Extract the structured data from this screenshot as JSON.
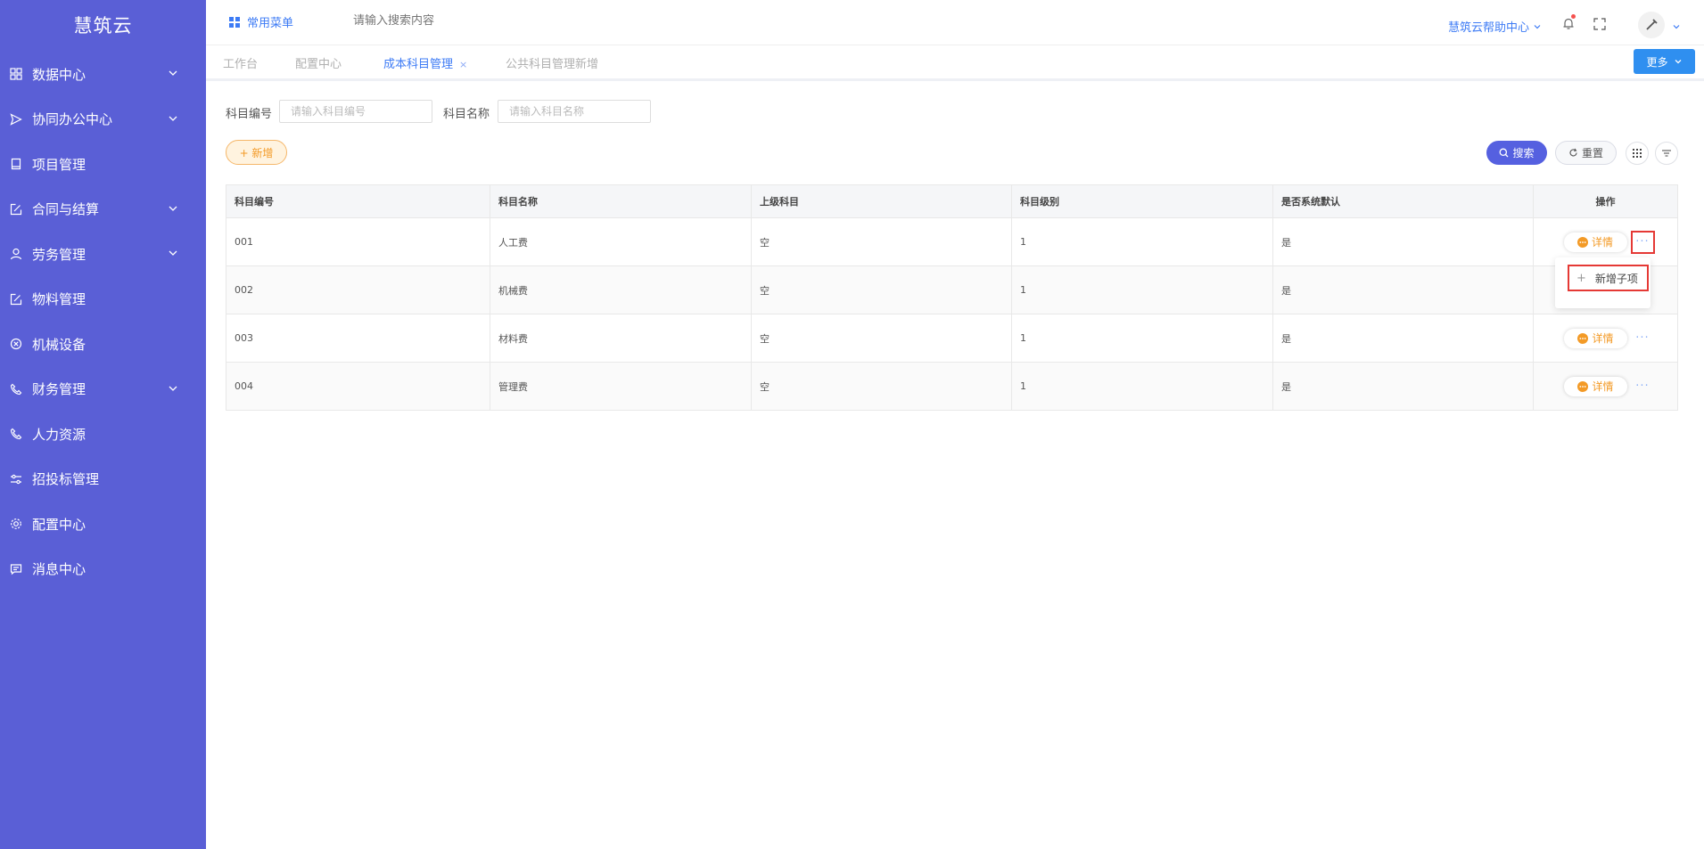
{
  "app": {
    "logo": "慧筑云"
  },
  "colors": {
    "sidebar_bg": "#5a5fd6",
    "accent": "#3d7bf5",
    "primary_btn": "#5560e0",
    "add_btn_text": "#f39a26",
    "highlight_box": "#e53935"
  },
  "sidebar": {
    "items": [
      {
        "label": "数据中心",
        "icon": "grid-icon",
        "has_chevron": true
      },
      {
        "label": "协同办公中心",
        "icon": "send-icon",
        "has_chevron": true
      },
      {
        "label": "项目管理",
        "icon": "book-icon",
        "has_chevron": false
      },
      {
        "label": "合同与结算",
        "icon": "edit-icon",
        "has_chevron": true
      },
      {
        "label": "劳务管理",
        "icon": "user-icon",
        "has_chevron": true
      },
      {
        "label": "物料管理",
        "icon": "edit-icon",
        "has_chevron": false
      },
      {
        "label": "机械设备",
        "icon": "close-circle-icon",
        "has_chevron": false
      },
      {
        "label": "财务管理",
        "icon": "phone-icon",
        "has_chevron": true
      },
      {
        "label": "人力资源",
        "icon": "phone-icon",
        "has_chevron": false
      },
      {
        "label": "招投标管理",
        "icon": "sliders-icon",
        "has_chevron": false
      },
      {
        "label": "配置中心",
        "icon": "gear-icon",
        "has_chevron": false
      },
      {
        "label": "消息中心",
        "icon": "message-icon",
        "has_chevron": false
      }
    ]
  },
  "topbar": {
    "menu_label": "常用菜单",
    "search_placeholder": "请输入搜索内容",
    "help_label": "慧筑云帮助中心"
  },
  "tabs": [
    {
      "label": "工作台",
      "active": false
    },
    {
      "label": "配置中心",
      "active": false
    },
    {
      "label": "成本科目管理",
      "active": true,
      "closable": true,
      "close_glyph": "×"
    },
    {
      "label": "公共科目管理新增",
      "active": false
    }
  ],
  "more_button": "更多",
  "filters": {
    "code_label": "科目编号",
    "code_placeholder": "请输入科目编号",
    "name_label": "科目名称",
    "name_placeholder": "请输入科目名称"
  },
  "actions": {
    "add": "+ 新增",
    "search": "搜索",
    "reset": "重置"
  },
  "table": {
    "columns": [
      "科目编号",
      "科目名称",
      "上级科目",
      "科目级别",
      "是否系统默认",
      "操作"
    ],
    "rows": [
      [
        "001",
        "人工费",
        "空",
        "1",
        "是"
      ],
      [
        "002",
        "机械费",
        "空",
        "1",
        "是"
      ],
      [
        "003",
        "材料费",
        "空",
        "1",
        "是"
      ],
      [
        "004",
        "管理费",
        "空",
        "1",
        "是"
      ]
    ],
    "detail_label": "详情",
    "more_glyph": "···"
  },
  "dropdown": {
    "item_label": "新增子项",
    "item_glyph": "+"
  }
}
